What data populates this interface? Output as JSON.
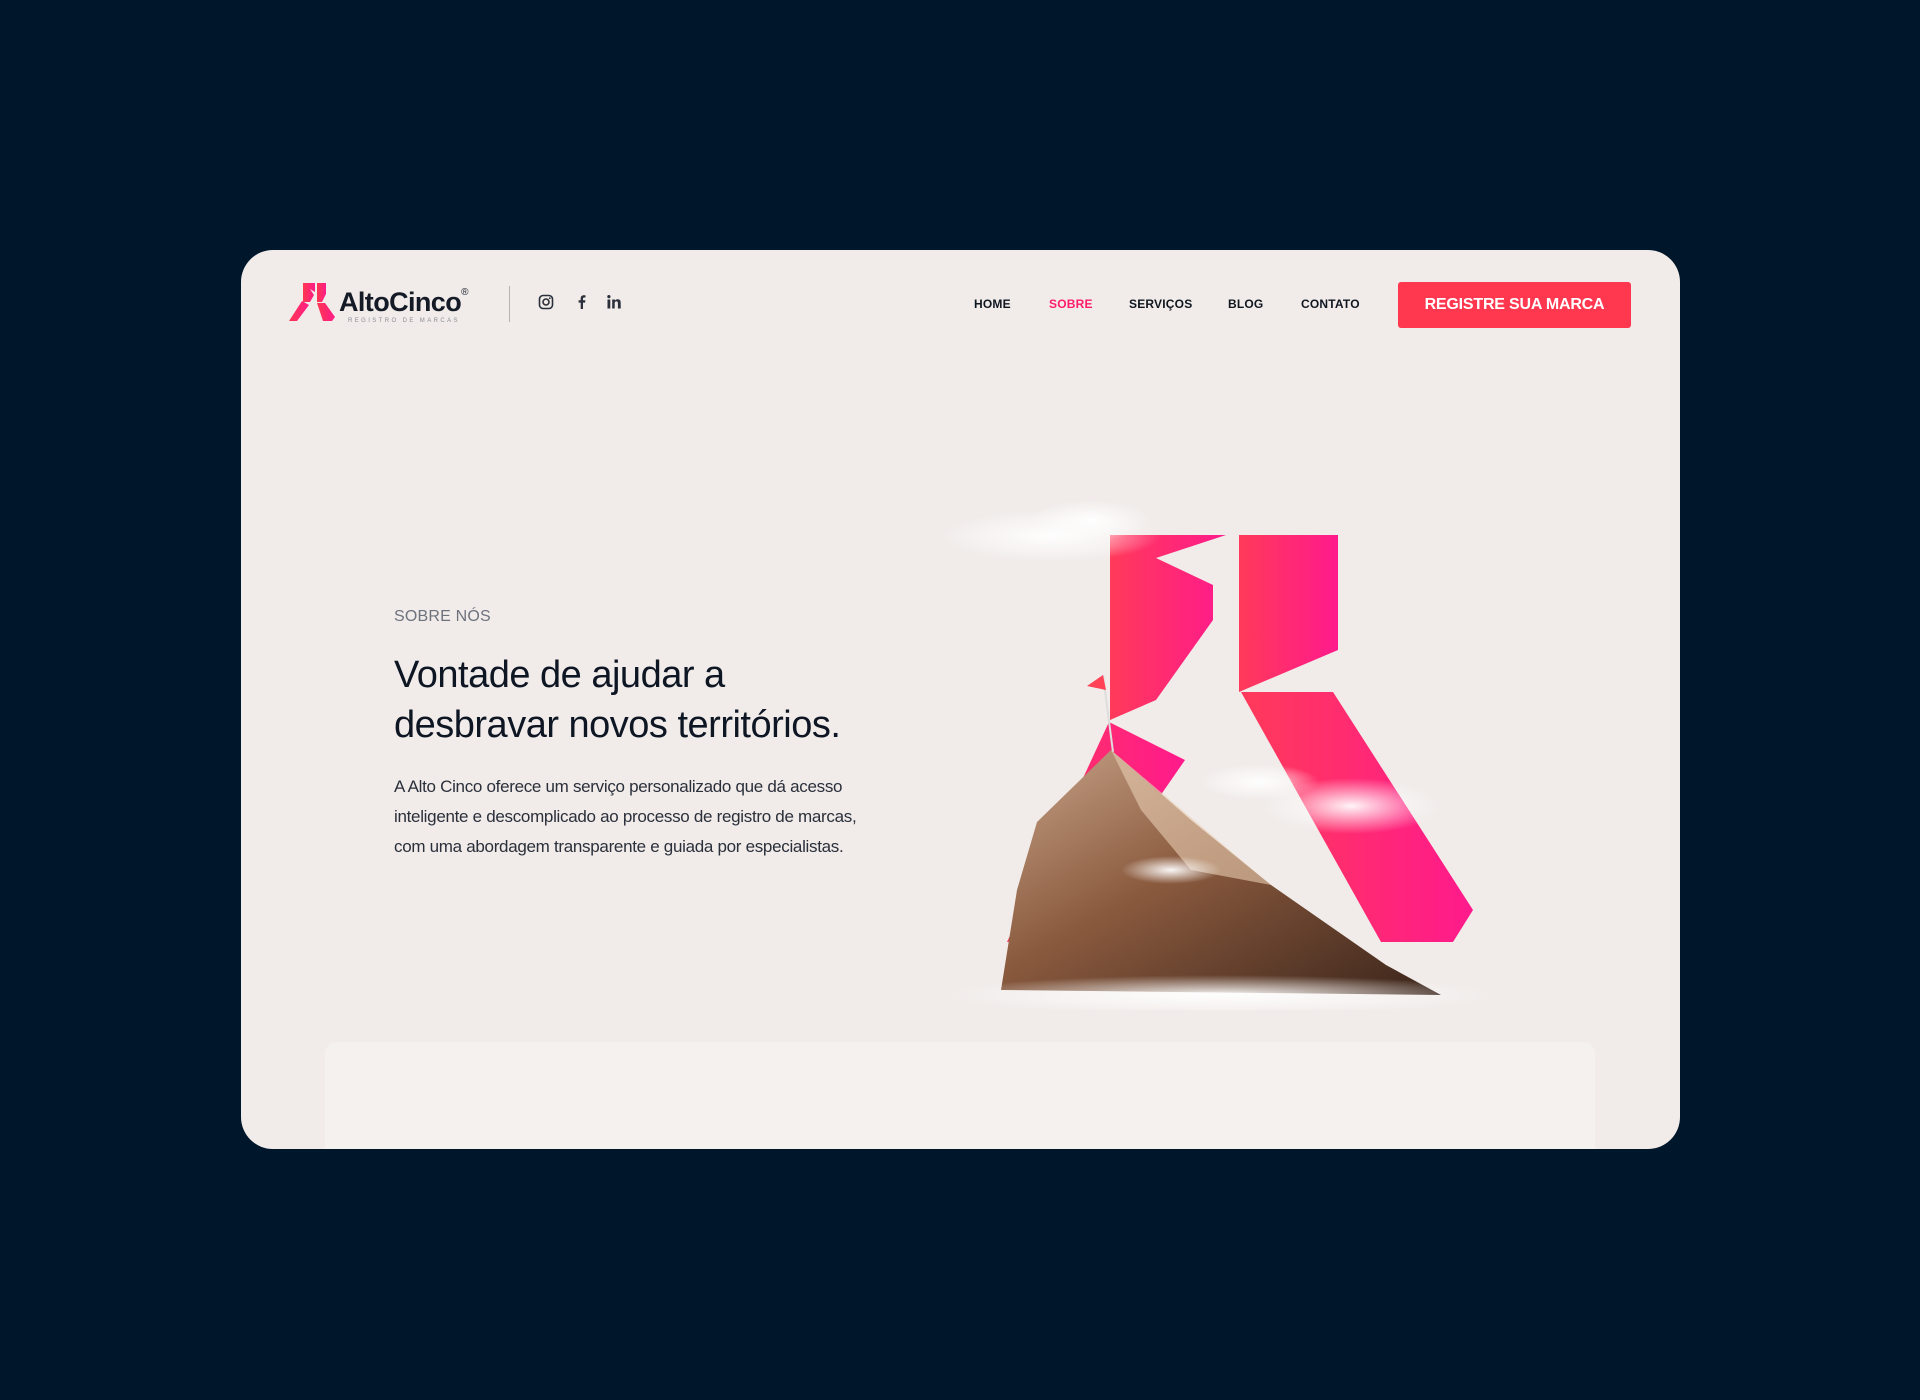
{
  "brand": {
    "name": "AltoCinco",
    "registered": "®",
    "tagline": "REGISTRO DE MARCAS",
    "accent": "#ff1b6b",
    "cta_color": "#ff3850"
  },
  "social": [
    "instagram-icon",
    "facebook-icon",
    "linkedin-icon"
  ],
  "nav": {
    "home": "HOME",
    "sobre": "SOBRE",
    "servicos": "SERVIÇOS",
    "blog": "BLOG",
    "contato": "CONTATO",
    "active": "SOBRE"
  },
  "cta": {
    "label": "REGISTRE SUA MARCA"
  },
  "hero": {
    "eyebrow": "SOBRE NÓS",
    "headline_line1": "Vontade de ajudar a",
    "headline_line2": "desbravar novos territórios.",
    "body_line1": "A Alto Cinco oferece um serviço personalizado que dá acesso",
    "body_line2": "inteligente e descomplicado ao processo de registro de marcas,",
    "body_line3": "com uma abordagem transparente e guiada por especialistas."
  },
  "colors": {
    "page_bg": "#00162a",
    "card_bg": "#f1ecea",
    "text_dark": "#0e1623"
  }
}
